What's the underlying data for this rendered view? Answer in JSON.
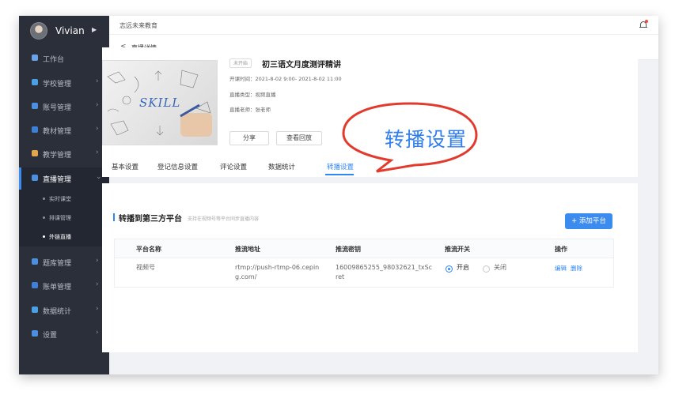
{
  "user": {
    "name": "Vivian"
  },
  "sidebar": {
    "items": [
      {
        "label": "工作台",
        "icon": "dashboard-icon"
      },
      {
        "label": "学校管理",
        "icon": "school-icon"
      },
      {
        "label": "账号管理",
        "icon": "account-icon"
      },
      {
        "label": "教材管理",
        "icon": "book-icon"
      },
      {
        "label": "教学管理",
        "icon": "teaching-icon"
      },
      {
        "label": "直播管理",
        "icon": "live-icon"
      },
      {
        "label": "题库管理",
        "icon": "question-bank-icon"
      },
      {
        "label": "账单管理",
        "icon": "bill-icon"
      },
      {
        "label": "数据统计",
        "icon": "chart-icon"
      },
      {
        "label": "设置",
        "icon": "settings-icon"
      }
    ],
    "sub_items": [
      {
        "label": "实时课堂"
      },
      {
        "label": "排课管理"
      },
      {
        "label": "外链直播"
      }
    ]
  },
  "topbar": {
    "org": "志远未来教育"
  },
  "breadcrumb": {
    "back": "<",
    "title": "直播详情"
  },
  "course": {
    "status": "未开始",
    "title": "初三语文月度测评精讲",
    "time": "开课时间：2021-8-02 9:00- 2021-8-02 11:00",
    "type": "直播类型：视频直播",
    "teacher": "直播老师：张老师",
    "share_label": "分享",
    "replay_label": "查看回放",
    "cover_text": "SKILL"
  },
  "tabs": [
    "基本设置",
    "登记信息设置",
    "评论设置",
    "数据统计",
    "转播设置"
  ],
  "callout": {
    "text": "转播设置"
  },
  "panel": {
    "title": "转播到第三方平台",
    "hint": "支持在视频号等平台同步直播内容",
    "add_label": "+ 添加平台"
  },
  "table": {
    "headers": [
      "平台名称",
      "推流地址",
      "推流密钥",
      "推流开关",
      "操作"
    ],
    "rows": [
      {
        "platform": "视频号",
        "url_line1": "rtmp://push-rtmp-06.cepin",
        "url_line2": "g.com/",
        "key_line1": "16009865255_98032621_txSc",
        "key_line2": "ret",
        "on_label": "开启",
        "off_label": "关闭",
        "edit_label": "编辑",
        "delete_label": "删除"
      }
    ]
  },
  "colors": {
    "accent": "#2f86f6",
    "sidebar": "#2b2f3a"
  }
}
